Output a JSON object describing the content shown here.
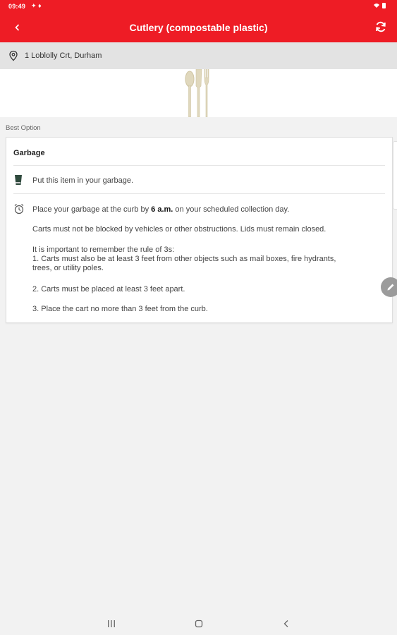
{
  "status_bar": {
    "time": "09:49"
  },
  "header": {
    "title": "Cutlery (compostable plastic)"
  },
  "location": {
    "address": "1 Loblolly Crt, Durham"
  },
  "section": {
    "label": "Best Option"
  },
  "card": {
    "title": "Garbage",
    "instruction": "Put this item in your garbage.",
    "schedule": {
      "prefix": "Place your garbage at the curb by ",
      "time": "6 a.m.",
      "suffix": " on your scheduled collection day."
    },
    "paragraphs": [
      "Carts must not be blocked by vehicles or other obstructions. Lids must remain closed.",
      "It is important to remember the rule of 3s:",
      "1. Carts must also be at least 3 feet from other objects such as mail boxes, fire hydrants,",
      "trees, or utility poles.",
      "2. Carts must be placed at least 3 feet apart.",
      "3. Place the cart no more than 3 feet from the curb."
    ]
  },
  "colors": {
    "brand": "#ee1c25",
    "garbage_icon": "#2f4a3d"
  },
  "icons": [
    "back-arrow-icon",
    "refresh-icon",
    "location-pin-icon",
    "garbage-bin-icon",
    "alarm-clock-icon",
    "pencil-icon"
  ]
}
